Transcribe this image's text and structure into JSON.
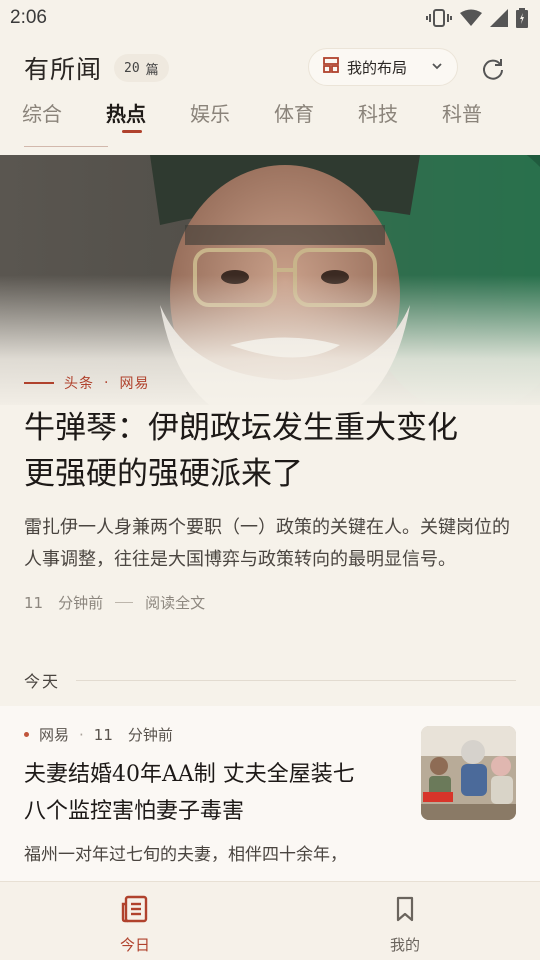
{
  "status_bar": {
    "time": "2:06"
  },
  "header": {
    "app_title": "有所闻",
    "count": "20",
    "count_unit": "篇",
    "layout_label": "我的布局"
  },
  "tabs": [
    {
      "label": "综合",
      "active": false
    },
    {
      "label": "热点",
      "active": true
    },
    {
      "label": "娱乐",
      "active": false
    },
    {
      "label": "体育",
      "active": false
    },
    {
      "label": "科技",
      "active": false
    },
    {
      "label": "科普",
      "active": false
    }
  ],
  "hero": {
    "tag": "头条",
    "dot": "·",
    "source": "网易",
    "title_line1": "牛弹琴：伊朗政坛发生重大变化",
    "title_line2": "更强硬的强硬派来了",
    "summary": "雷扎伊一人身兼两个要职（一）政策的关键在人。关键岗位的人事调整，往往是大国博弈与政策转向的最明显信号。",
    "time": "11　分钟前",
    "read_full": "阅读全文"
  },
  "section": {
    "label": "今天"
  },
  "card": {
    "source": "网易",
    "sep": "·",
    "time": "11　分钟前",
    "title_line1": "夫妻结婚40年AA制 丈夫全屋装七",
    "title_line2": "八个监控害怕妻子毒害",
    "summary": "福州一对年过七旬的夫妻，相伴四十余年，"
  },
  "bottom_nav": {
    "today_label": "今日",
    "mine_label": "我的"
  },
  "colors": {
    "accent": "#b0422d",
    "background": "#f6f2ea"
  }
}
